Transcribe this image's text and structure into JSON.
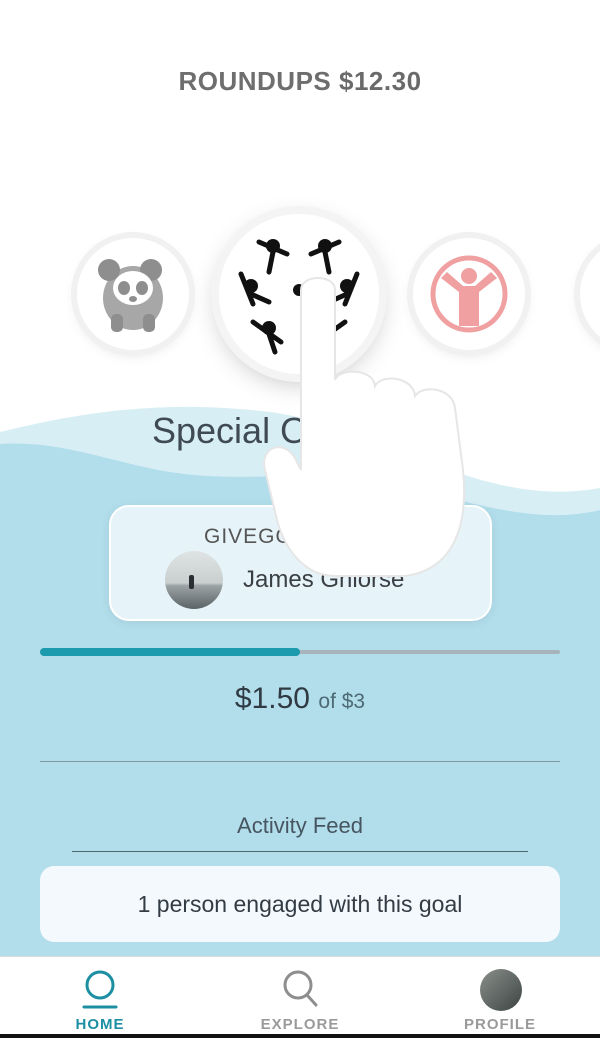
{
  "header": {
    "roundups_label": "ROUNDUPS",
    "roundups_amount": "$12.30"
  },
  "carousel": {
    "charities": [
      {
        "icon": "panda-icon",
        "color": "#9a9a9a"
      },
      {
        "icon": "special-olympics-icon",
        "color": "#111111",
        "selected": true
      },
      {
        "icon": "child-hands-up-icon",
        "color": "#f0a0a0"
      }
    ]
  },
  "selected_charity": {
    "name": "Special Olympics"
  },
  "goal": {
    "label": "GIVEGOAL",
    "user_name": "James Ghiorse"
  },
  "progress": {
    "raised": "$1.50",
    "of_label": "of $3",
    "fraction": 0.5
  },
  "activity": {
    "title": "Activity Feed",
    "entries": [
      "1 person engaged with this goal"
    ]
  },
  "tabbar": {
    "home": "HOME",
    "explore": "EXPLORE",
    "profile": "PROFILE"
  },
  "colors": {
    "accent": "#1c9aae",
    "wave": "#b3dfec",
    "wave_light": "#d6eef5"
  }
}
